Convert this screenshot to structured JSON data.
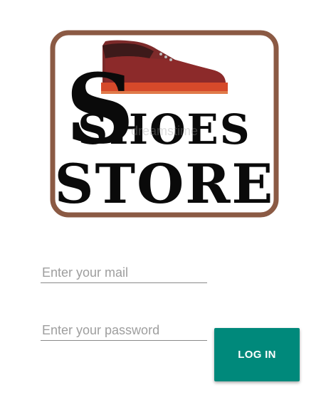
{
  "logo": {
    "line1": "SHOES",
    "line2": "STORE",
    "watermark": "dreamstime",
    "border_color": "#8b5a44",
    "shoe_color": "#8c2a2a"
  },
  "form": {
    "mail_placeholder": "Enter your mail",
    "password_placeholder": "Enter your password",
    "login_label": "LOG IN",
    "accent_color": "#00897b"
  }
}
